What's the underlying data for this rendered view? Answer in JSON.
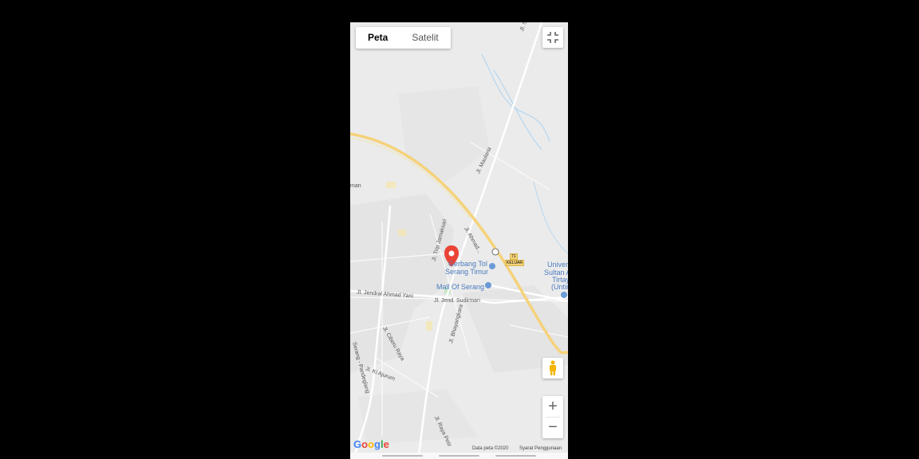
{
  "map_type": {
    "map_label": "Peta",
    "satellite_label": "Satelit"
  },
  "roads": {
    "sawah": "Jl. Sawah L.",
    "maulana": "Jl. Maulana",
    "man": "man",
    "tirtayasa": "Jl. Trip Jamaksari",
    "ahmad": "Jl. Ahmad...",
    "yani": "Jl. Jendral Ahmad Yani",
    "sudirman": "Jl. Jend. Sudirman",
    "bhayangkara": "Jl. Bhayangkara",
    "cibeny": "Jl. Ciberu Raya",
    "ajudan": "Jl. Ki Ajurum",
    "pandeglang": "Serang - Pandeglang",
    "raya_petir": "Jl. Raya Petir"
  },
  "pois": {
    "gerbang": "Gerbang Tol",
    "gerbang2": "Serang Timur",
    "mall": "Mall Of Serang",
    "univ1": "Univers",
    "univ2": "Sultan A",
    "univ3": "Tirtay",
    "univ4": "(Untir"
  },
  "exit": {
    "number": "71",
    "label": "KELUAR"
  },
  "footer": {
    "data": "Data peta ©2020",
    "terms": "Syarat Penggunaan"
  },
  "logo": "Google",
  "controls": {
    "zoom_in": "+",
    "zoom_out": "−"
  },
  "colors": {
    "highway": "#f5d27a",
    "road": "#ffffff",
    "land": "#ebebeb",
    "marker": "#ea4335",
    "water": "#aad3f2"
  }
}
